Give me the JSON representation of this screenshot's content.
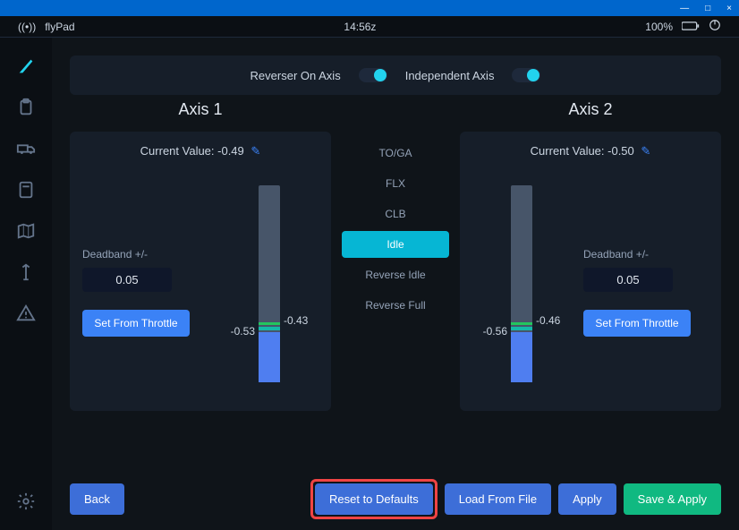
{
  "titlebar": {
    "minimize": "—",
    "maximize": "□",
    "close": "×"
  },
  "status": {
    "app_name": "flyPad",
    "time": "14:56z",
    "battery_pct": "100%"
  },
  "toggles": {
    "reverser_label": "Reverser On Axis",
    "independent_label": "Independent Axis"
  },
  "detents": {
    "items": [
      {
        "label": "TO/GA"
      },
      {
        "label": "FLX"
      },
      {
        "label": "CLB"
      },
      {
        "label": "Idle",
        "active": true
      },
      {
        "label": "Reverse Idle"
      },
      {
        "label": "Reverse Full"
      }
    ]
  },
  "axis1": {
    "title": "Axis 1",
    "current_label": "Current Value: -0.49",
    "deadband_label": "Deadband +/-",
    "deadband_value": "0.05",
    "set_button": "Set From Throttle",
    "gauge_low": "-0.53",
    "gauge_high": "-0.43"
  },
  "axis2": {
    "title": "Axis 2",
    "current_label": "Current Value: -0.50",
    "deadband_label": "Deadband +/-",
    "deadband_value": "0.05",
    "set_button": "Set From Throttle",
    "gauge_low": "-0.56",
    "gauge_high": "-0.46"
  },
  "footer": {
    "back": "Back",
    "reset": "Reset to Defaults",
    "load": "Load From File",
    "apply": "Apply",
    "save_apply": "Save & Apply"
  }
}
